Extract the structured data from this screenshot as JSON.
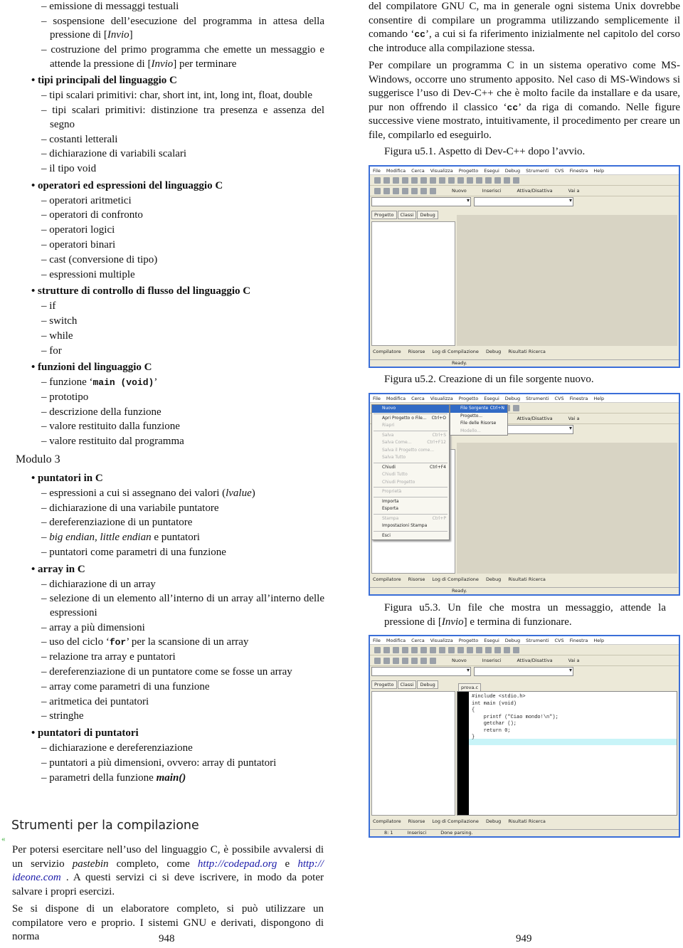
{
  "left_list": [
    {
      "t": "l2",
      "text": "emissione di messaggi testuali"
    },
    {
      "t": "l2",
      "html": "sospensione dell’esecuzione del programma in attesa della pressione di [<i>Invio</i>]"
    },
    {
      "t": "l2",
      "html": "costruzione del primo programma che emette un messaggio e attende la pressione di [<i>Invio</i>] per terminare"
    },
    {
      "t": "l1",
      "text": "tipi principali del linguaggio C"
    },
    {
      "t": "l2",
      "text": "tipi scalari primitivi: char, short int, int, long int, float, double"
    },
    {
      "t": "l2",
      "text": "tipi scalari primitivi: distinzione tra presenza e assenza del segno"
    },
    {
      "t": "l2",
      "text": "costanti letterali"
    },
    {
      "t": "l2",
      "text": "dichiarazione di variabili scalari"
    },
    {
      "t": "l2",
      "text": "il tipo void"
    },
    {
      "t": "l1",
      "text": "operatori ed espressioni del linguaggio C"
    },
    {
      "t": "l2",
      "text": "operatori aritmetici"
    },
    {
      "t": "l2",
      "text": "operatori di confronto"
    },
    {
      "t": "l2",
      "text": "operatori logici"
    },
    {
      "t": "l2",
      "text": "operatori binari"
    },
    {
      "t": "l2",
      "text": "cast (conversione di tipo)"
    },
    {
      "t": "l2",
      "text": "espressioni multiple"
    },
    {
      "t": "l1",
      "text": "strutture di controllo di flusso del linguaggio C"
    },
    {
      "t": "l2",
      "text": "if"
    },
    {
      "t": "l2",
      "text": "switch"
    },
    {
      "t": "l2",
      "text": "while"
    },
    {
      "t": "l2",
      "text": "for"
    },
    {
      "t": "l1",
      "text": "funzioni del linguaggio C"
    },
    {
      "t": "l2",
      "html": "funzione ‘<span class=\"mono\">main (void)</span>’"
    },
    {
      "t": "l2",
      "text": "prototipo"
    },
    {
      "t": "l2",
      "text": "descrizione della funzione"
    },
    {
      "t": "l2",
      "text": "valore restituito dalla funzione"
    },
    {
      "t": "l2",
      "text": "valore restituito dal programma"
    },
    {
      "t": "mod",
      "text": "Modulo 3"
    },
    {
      "t": "l1",
      "text": "puntatori in C"
    },
    {
      "t": "l2",
      "html": "espressioni a cui si assegnano dei valori (<i>lvalue</i>)"
    },
    {
      "t": "l2",
      "text": "dichiarazione di una variabile puntatore"
    },
    {
      "t": "l2",
      "text": "dereferenziazione di un puntatore"
    },
    {
      "t": "l2",
      "html": "<i>big endian</i>, <i>little endian</i> e puntatori"
    },
    {
      "t": "l2",
      "text": "puntatori come parametri di una funzione"
    },
    {
      "t": "l1",
      "text": "array in C"
    },
    {
      "t": "l2",
      "text": "dichiarazione di un array"
    },
    {
      "t": "l2",
      "text": "selezione di un elemento all’interno di un array all’interno delle espressioni"
    },
    {
      "t": "l2",
      "text": "array a più dimensioni"
    },
    {
      "t": "l2",
      "html": "uso del ciclo ‘<span class=\"mono\">for</span>’ per la scansione di un array"
    },
    {
      "t": "l2",
      "text": "relazione tra array e puntatori"
    },
    {
      "t": "l2",
      "text": "dereferenziazione di un puntatore come se fosse un array"
    },
    {
      "t": "l2",
      "text": "array come parametri di una funzione"
    },
    {
      "t": "l2",
      "text": "aritmetica dei puntatori"
    },
    {
      "t": "l2",
      "text": "stringhe"
    },
    {
      "t": "l1",
      "text": "puntatori di puntatori"
    },
    {
      "t": "l2",
      "text": "dichiarazione e dereferenziazione"
    },
    {
      "t": "l2",
      "text": "puntatori a più dimensioni, ovvero: array di puntatori"
    },
    {
      "t": "l2",
      "html": "parametri della funzione <b><i>main()</i></b>"
    }
  ],
  "section_title": "Strumenti per la compilazione",
  "section_mark": "«",
  "left_paras": [
    "Per potersi esercitare nell’uso del linguaggio C, è possibile avvalersi di un servizio <i>pastebin</i> completo, come <a>http://codepad.org</a> e <a>http:// ideone.com</a> . A questi servizi ci si deve iscrivere, in modo da poter salvare i propri esercizi.",
    "Se si dispone di un elaboratore completo, si può utilizzare un compilatore vero e proprio. I sistemi GNU e derivati, dispongono di norma"
  ],
  "right_paras": [
    "del compilatore GNU C, ma in generale ogni sistema Unix dovrebbe consentire di compilare un programma utilizzando semplicemente il comando ‘<span class=\"mono\">cc</span>’, a cui si fa riferimento inizialmente nel capitolo del corso che introduce alla compilazione stessa.",
    "Per compilare un programma C in un sistema operativo come MS-Windows, occorre uno strumento apposito. Nel caso di MS-Windows si suggerisce l’uso di Dev-C++ che è molto facile da installare e da usare, pur non offrendo il classico ‘<span class=\"mono\">cc</span>’ da riga di comando. Nelle figure successive viene mostrato, intuitivamente, il procedimento per creare un file, compilarlo ed eseguirlo."
  ],
  "captions": [
    "Figura u5.1. Aspetto di Dev-C++ dopo l’avvio.",
    "Figura u5.2. Creazione di un file sorgente nuovo.",
    "Figura u5.3. Un file che mostra un messaggio, attende la pressione di [<i>Invio</i>] e termina di funzionare."
  ],
  "devcpp": {
    "menu": [
      "File",
      "Modifica",
      "Cerca",
      "Visualizza",
      "Progetto",
      "Esegui",
      "Debug",
      "Strumenti",
      "CVS",
      "Finestra",
      "Help"
    ],
    "toolbar2": [
      "Nuovo",
      "Inserisci",
      "Attiva/Disattiva",
      "Vai a"
    ],
    "side_tabs": [
      "Progetto",
      "Classi",
      "Debug"
    ],
    "bottom_tabs": [
      "Compilatore",
      "Risorse",
      "Log di Compilazione",
      "Debug",
      "Risultati Ricerca"
    ],
    "status_ready": "Ready.",
    "file_menu": [
      [
        "Nuovo",
        ""
      ],
      [
        "Apri Progetto o File...",
        "Ctrl+O"
      ],
      [
        "Riapri",
        ""
      ],
      [
        "Salva",
        "Ctrl+S"
      ],
      [
        "Salva Come...",
        "Ctrl+F12"
      ],
      [
        "Salva il Progetto come...",
        ""
      ],
      [
        "Salva Tutto",
        ""
      ],
      [
        "Chiudi",
        "Ctrl+F4"
      ],
      [
        "Chiudi Tutto",
        ""
      ],
      [
        "Chiudi Progetto",
        ""
      ],
      [
        "Proprietà",
        ""
      ],
      [
        "Importa",
        ""
      ],
      [
        "Esporta",
        ""
      ],
      [
        "Stampa",
        "Ctrl+P"
      ],
      [
        "Impostazioni Stampa",
        ""
      ],
      [
        "Esci",
        ""
      ]
    ],
    "new_submenu": [
      [
        "File Sorgente",
        "Ctrl+N"
      ],
      [
        "Progetto...",
        ""
      ],
      [
        "File delle Risorse",
        ""
      ],
      [
        "Modello...",
        ""
      ]
    ],
    "file_tab": "prova.c",
    "code": "#include <stdio.h>\nint main (void)\n{\n    printf (\"Ciao mondo!\\n\");\n    getchar ();\n    return 0;\n}",
    "status3": [
      "8: 1",
      "Inserisci",
      "Done parsing."
    ]
  },
  "page_numbers": [
    "948",
    "949"
  ],
  "colors": {
    "link": "#1a1aa8",
    "window_border": "#3a6ed8",
    "menu_selected": "#316ac5"
  }
}
